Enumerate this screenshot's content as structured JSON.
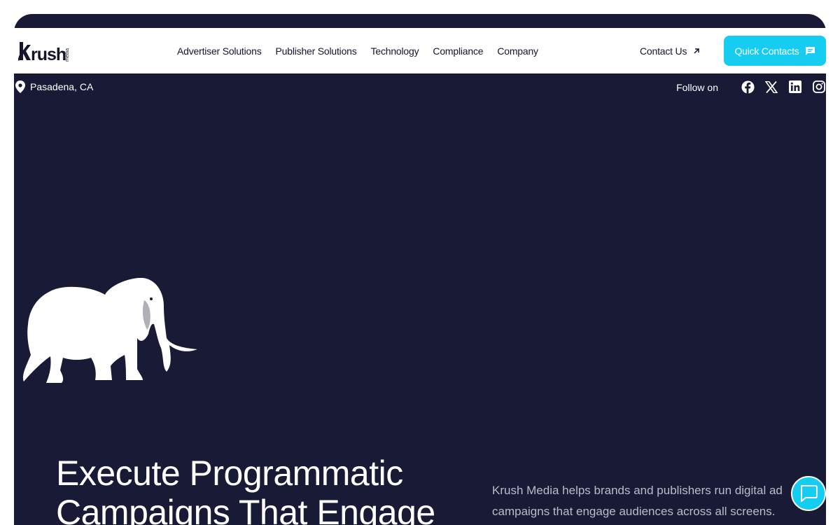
{
  "brand": {
    "logo_text": "krush",
    "logo_sub": "media"
  },
  "nav": {
    "links": [
      "Advertiser Solutions",
      "Publisher Solutions",
      "Technology",
      "Compliance",
      "Company"
    ],
    "contact_label": "Contact Us",
    "quick_contacts_label": "Quick Contacts"
  },
  "info_bar": {
    "location": "Pasadena, CA",
    "follow_label": "Follow on",
    "socials": [
      "facebook-icon",
      "x-icon",
      "linkedin-icon",
      "instagram-icon"
    ]
  },
  "hero": {
    "headline": "Execute Programmatic Campaigns That Engage",
    "description": "Krush Media helps brands and publishers run digital ad campaigns that engage audiences across all screens."
  },
  "colors": {
    "background": "#191a35",
    "accent": "#14cdf0",
    "nav_text": "#14152b",
    "muted_text": "#b9bccb"
  }
}
